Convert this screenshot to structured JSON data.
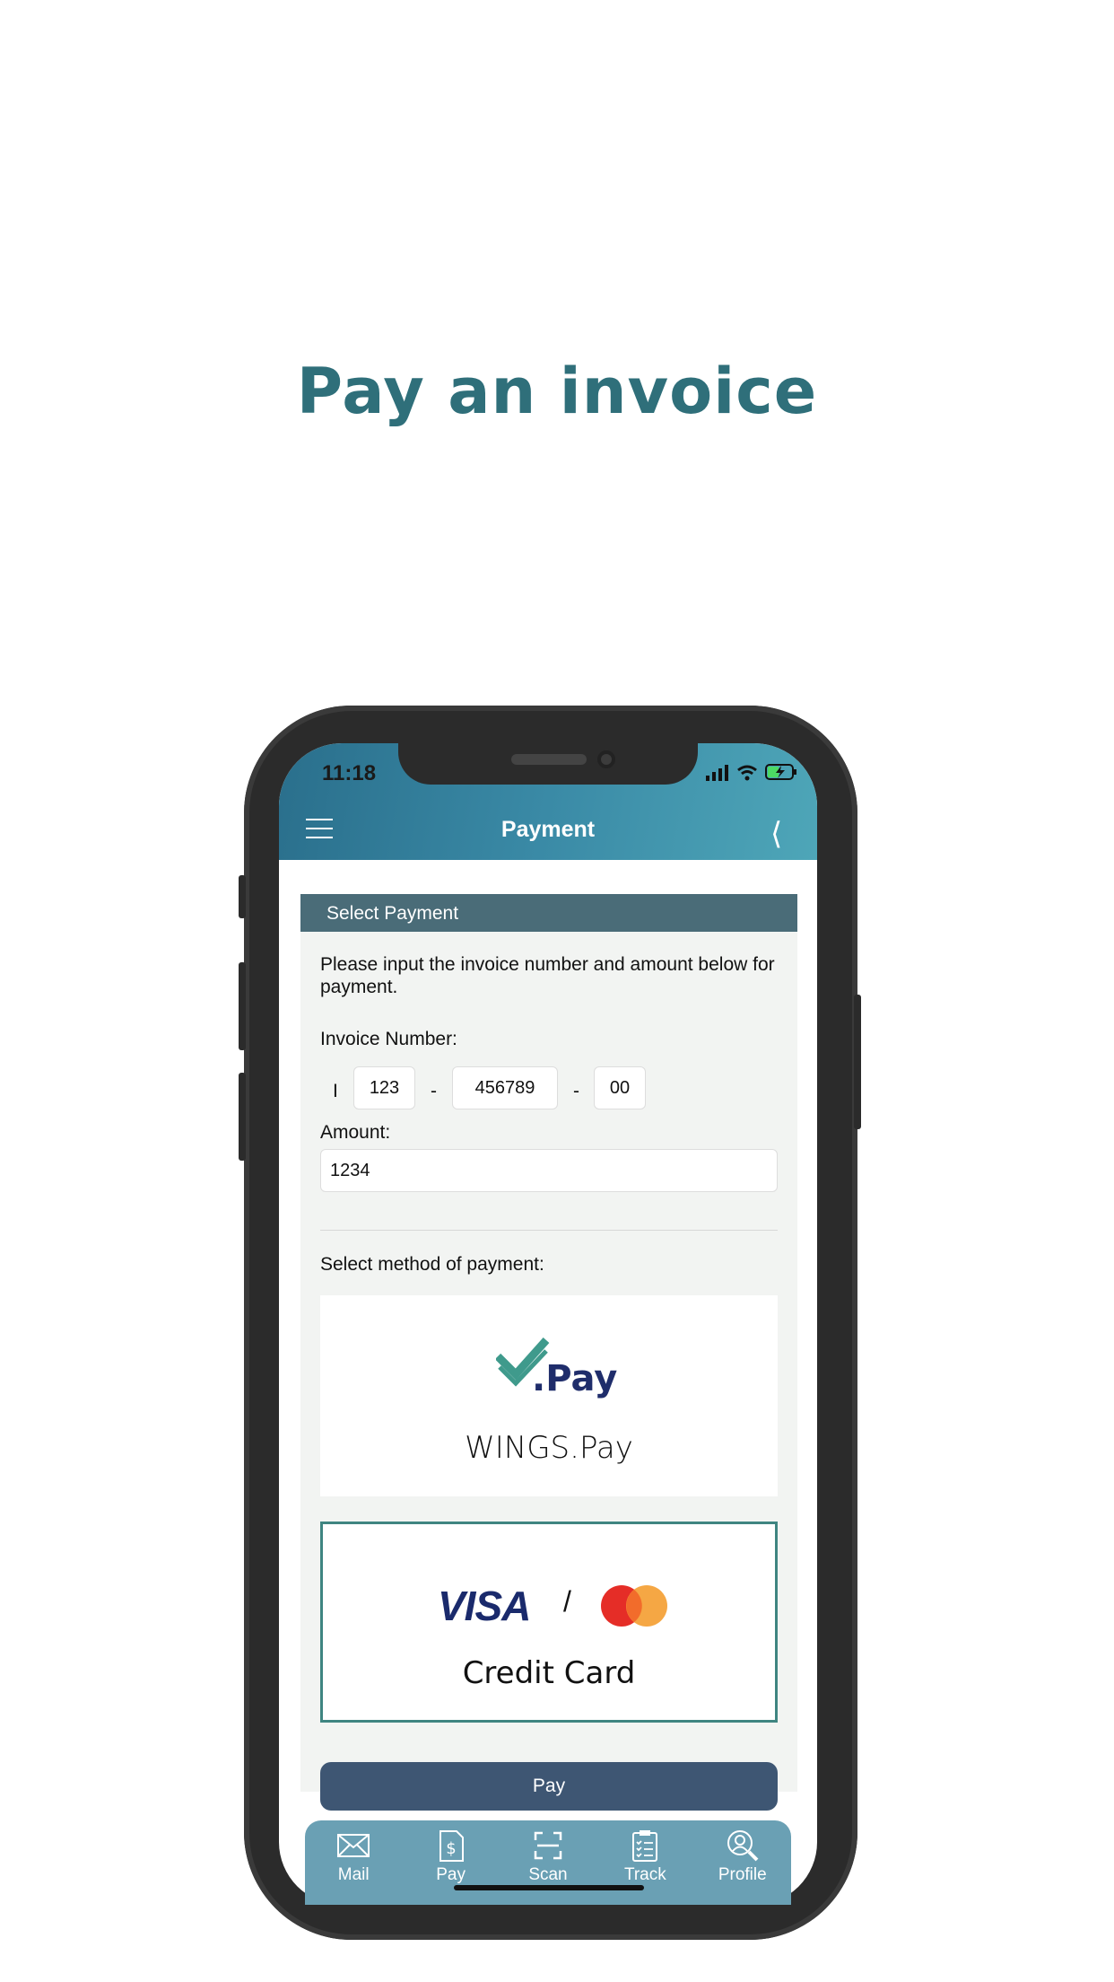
{
  "headline": "Pay an invoice",
  "status_bar": {
    "time": "11:18"
  },
  "header": {
    "title": "Payment"
  },
  "section": {
    "title": "Select Payment"
  },
  "instructions": "Please input the invoice number and amount below for payment.",
  "invoice": {
    "label": "Invoice Number:",
    "prefix": "I",
    "part1": "123",
    "part2": "456789",
    "part3": "00",
    "separator": "-"
  },
  "amount": {
    "label": "Amount:",
    "value": "1234"
  },
  "method": {
    "label": "Select method of payment:",
    "options": [
      {
        "logo_text": ".Pay",
        "label": "WINGS.Pay",
        "selected": false
      },
      {
        "logo_text": "VISA",
        "divider": "/",
        "label": "Credit Card",
        "selected": true
      }
    ]
  },
  "pay_button": "Pay",
  "tabs": [
    {
      "label": "Mail",
      "icon": "mail-icon"
    },
    {
      "label": "Pay",
      "icon": "pay-document-icon"
    },
    {
      "label": "Scan",
      "icon": "scan-icon"
    },
    {
      "label": "Track",
      "icon": "clipboard-icon"
    },
    {
      "label": "Profile",
      "icon": "profile-search-icon"
    }
  ],
  "colors": {
    "headline": "#2f6f7a",
    "section_bar": "#4a6c78",
    "pay_button": "#3e5673",
    "tab_bar": "#6aa0b4",
    "selected_border": "#3f8581"
  }
}
